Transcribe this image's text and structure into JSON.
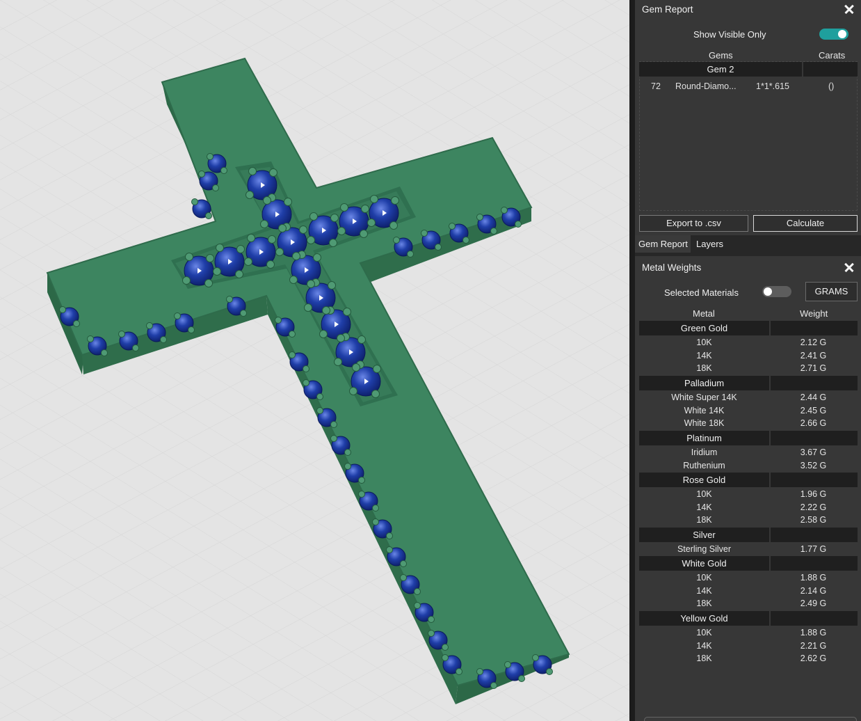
{
  "gem_report": {
    "title": "Gem Report",
    "show_visible_only_label": "Show Visible Only",
    "show_visible_only": true,
    "columns": {
      "gems": "Gems",
      "carats": "Carats"
    },
    "groups": [
      {
        "name": "Gem 2",
        "rows": [
          {
            "count": "72",
            "shape": "Round-Diamo...",
            "size": "1*1*.615",
            "carats": "()"
          }
        ]
      }
    ],
    "export_label": "Export to .csv",
    "calculate_label": "Calculate"
  },
  "tabs": [
    {
      "label": "Gem Report",
      "active": true
    },
    {
      "label": "Layers",
      "active": false
    }
  ],
  "metal_weights": {
    "title": "Metal Weights",
    "selected_materials_label": "Selected Materials",
    "selected_materials": false,
    "units_label": "GRAMS",
    "columns": {
      "metal": "Metal",
      "weight": "Weight"
    },
    "groups": [
      {
        "name": "Green Gold",
        "items": [
          {
            "name": "10K",
            "weight": "2.12 G"
          },
          {
            "name": "14K",
            "weight": "2.41 G"
          },
          {
            "name": "18K",
            "weight": "2.71 G"
          }
        ]
      },
      {
        "name": "Palladium",
        "items": [
          {
            "name": "White Super 14K",
            "weight": "2.44 G"
          },
          {
            "name": "White 14K",
            "weight": "2.45 G"
          },
          {
            "name": "White 18K",
            "weight": "2.66 G"
          }
        ]
      },
      {
        "name": "Platinum",
        "items": [
          {
            "name": "Iridium",
            "weight": "3.67 G"
          },
          {
            "name": "Ruthenium",
            "weight": "3.52 G"
          }
        ]
      },
      {
        "name": "Rose Gold",
        "items": [
          {
            "name": "10K",
            "weight": "1.96 G"
          },
          {
            "name": "14K",
            "weight": "2.22 G"
          },
          {
            "name": "18K",
            "weight": "2.58 G"
          }
        ]
      },
      {
        "name": "Silver",
        "items": [
          {
            "name": "Sterling Silver",
            "weight": "1.77 G"
          }
        ]
      },
      {
        "name": "White Gold",
        "items": [
          {
            "name": "10K",
            "weight": "1.88 G"
          },
          {
            "name": "14K",
            "weight": "2.14 G"
          },
          {
            "name": "18K",
            "weight": "2.49 G"
          }
        ]
      },
      {
        "name": "Yellow Gold",
        "items": [
          {
            "name": "10K",
            "weight": "1.88 G"
          },
          {
            "name": "14K",
            "weight": "2.21 G"
          },
          {
            "name": "18K",
            "weight": "2.62 G"
          }
        ]
      }
    ]
  },
  "colors": {
    "metal_model": "#3d8560",
    "gem_model": "#1f3ea8",
    "toggle_on": "#1f9f9d",
    "panel_bg": "#373737",
    "viewport_bg": "#e4e4e4"
  }
}
